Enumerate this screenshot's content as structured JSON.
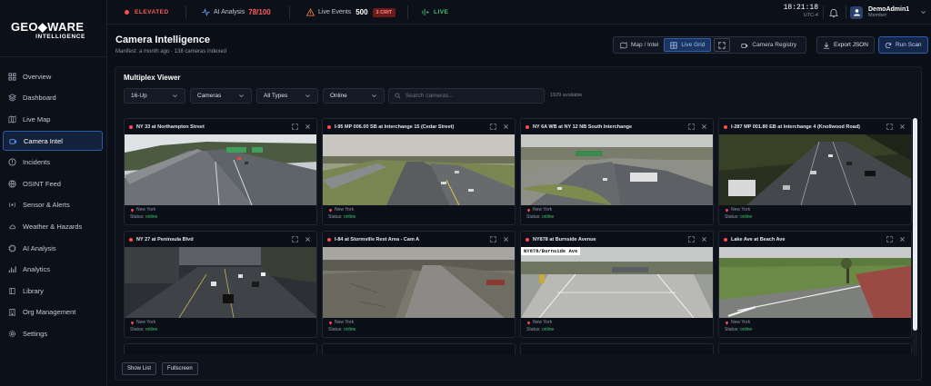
{
  "brand": {
    "line1": "GEO◆WARE",
    "line2": "INTELLIGENCE"
  },
  "sidebar": {
    "items": [
      {
        "label": "Overview",
        "icon": "grid-icon"
      },
      {
        "label": "Dashboard",
        "icon": "layers-icon"
      },
      {
        "label": "Live Map",
        "icon": "map-icon"
      },
      {
        "label": "Camera Intel",
        "icon": "camera-icon",
        "active": true
      },
      {
        "label": "Incidents",
        "icon": "alert-icon"
      },
      {
        "label": "OSINT Feed",
        "icon": "globe-icon"
      },
      {
        "label": "Sensor & Alerts",
        "icon": "sensor-icon"
      },
      {
        "label": "Weather & Hazards",
        "icon": "cloud-icon"
      },
      {
        "label": "AI Analysis",
        "icon": "brain-icon"
      },
      {
        "label": "Analytics",
        "icon": "chart-icon"
      },
      {
        "label": "Library",
        "icon": "book-icon"
      },
      {
        "label": "Org Management",
        "icon": "building-icon"
      },
      {
        "label": "Settings",
        "icon": "gear-icon"
      }
    ]
  },
  "topbar": {
    "threat_level": "ELEVATED",
    "ai_label": "AI Analysis",
    "ai_value": "78/100",
    "events_label": "Live Events",
    "events_value": "500",
    "crit_badge": "3 CRIT",
    "live_label": "LIVE",
    "time": "18:21:18",
    "timezone": "UTC-4",
    "user_name": "DemoAdmin1",
    "user_role": "Member"
  },
  "page": {
    "title": "Camera Intelligence",
    "subtitle": "Manifest: a month ago · 138 cameras indexed"
  },
  "view_toggle": {
    "map": "Map / Intel",
    "grid": "Live Grid",
    "registry": "Camera Registry"
  },
  "actions": {
    "export": "Export JSON",
    "scan": "Run Scan"
  },
  "viewer": {
    "title": "Multiplex Viewer",
    "layout": "16-Up",
    "source": "Cameras",
    "type": "All Types",
    "status": "Online",
    "search_placeholder": "Search cameras...",
    "available": "1929 available"
  },
  "cameras": [
    {
      "name": "NY 33 at Northampton Street",
      "location": "New York",
      "status_label": "Status:",
      "status": "online"
    },
    {
      "name": "I-95 MP 006.00 SB at Interchange 15 (Cedar Street)",
      "location": "New York",
      "status_label": "Status:",
      "status": "online"
    },
    {
      "name": "NY 6A WB at NY 12 NB South Interchange",
      "location": "New York",
      "status_label": "Status:",
      "status": "online"
    },
    {
      "name": "I-287 MP 001.80 EB at Interchange 4 (Knollwood Road)",
      "location": "New York",
      "status_label": "Status:",
      "status": "online"
    },
    {
      "name": "NY 27 at Peninsula Blvd",
      "location": "New York",
      "status_label": "Status:",
      "status": "online"
    },
    {
      "name": "I-84 at Stormville Rest Area - Cam A",
      "location": "New York",
      "status_label": "Status:",
      "status": "online"
    },
    {
      "name": "NY878 at Burnside Avenue",
      "location": "New York",
      "status_label": "Status:",
      "status": "online",
      "overlay": "NY878/Burnside Ave"
    },
    {
      "name": "Lake Ave at Beach Ave",
      "location": "New York",
      "status_label": "Status:",
      "status": "online"
    }
  ],
  "footer": {
    "show_list": "Show List",
    "fullscreen": "Fullscreen"
  },
  "colors": {
    "accent": "#2f5fb0",
    "alert": "#ff4d4d",
    "online": "#3ec46d"
  }
}
